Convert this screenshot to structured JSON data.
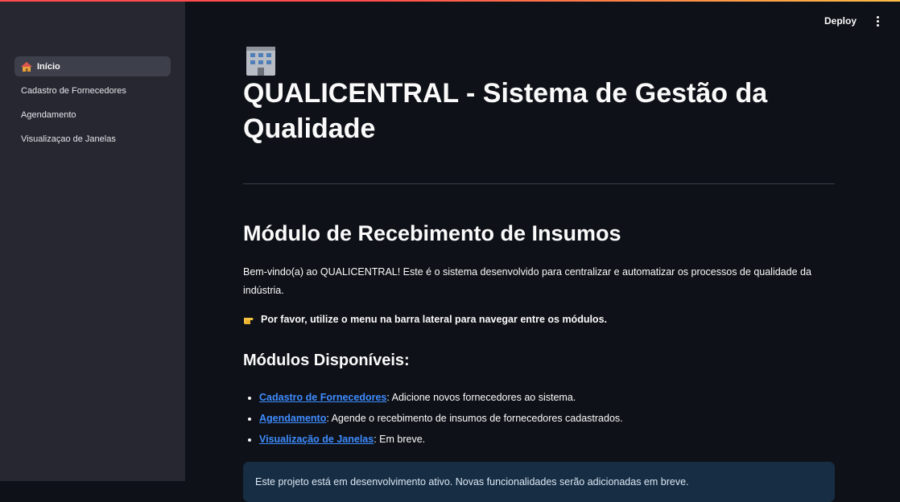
{
  "header": {
    "deploy_label": "Deploy",
    "menu_icon": "kebab-menu-icon"
  },
  "sidebar": {
    "items": [
      {
        "label": "Início",
        "icon": "house-icon",
        "active": true
      },
      {
        "label": "Cadastro de Fornecedores",
        "active": false
      },
      {
        "label": "Agendamento",
        "active": false
      },
      {
        "label": "Visualizaçao de Janelas",
        "active": false
      }
    ]
  },
  "main": {
    "title_icon": "office-building-icon",
    "title": "QUALICENTRAL - Sistema de Gestão da Qualidade",
    "section_title": "Módulo de Recebimento de Insumos",
    "intro": "Bem-vindo(a) ao QUALICENTRAL! Este é o sistema desenvolvido para centralizar e automatizar os processos de qualidade da indústria.",
    "hint_icon": "pointing-hand-icon",
    "hint": "Por favor, utilize o menu na barra lateral para navegar entre os módulos.",
    "modules_title": "Módulos Disponíveis:",
    "modules": [
      {
        "link": "Cadastro de Fornecedores",
        "desc": ": Adicione novos fornecedores ao sistema."
      },
      {
        "link": "Agendamento",
        "desc": ": Agende o recebimento de insumos de fornecedores cadastrados."
      },
      {
        "link": "Visualização de Janelas",
        "desc": ": Em breve."
      }
    ],
    "info": "Este projeto está em desenvolvimento ativo. Novas funcionalidades serão adicionadas em breve."
  },
  "colors": {
    "background": "#0e1117",
    "sidebar": "#262730",
    "link": "#3f8cff",
    "info_box": "#172d43",
    "accent": "#ff4b4b"
  }
}
